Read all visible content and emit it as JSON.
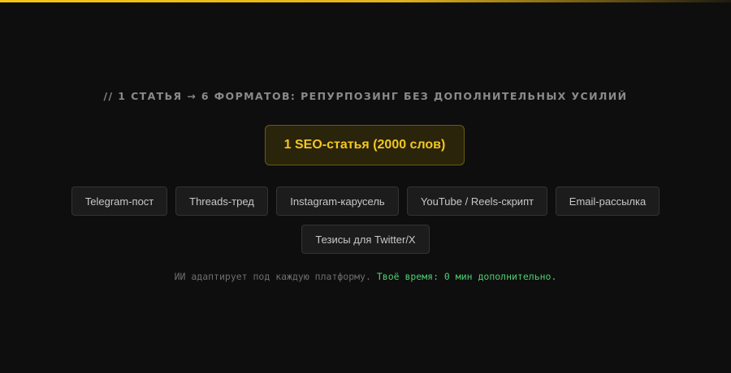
{
  "colors": {
    "accent_yellow": "#f3c623",
    "accent_green": "#4ccf72",
    "background": "#0e0e0e"
  },
  "heading": "// 1 СТАТЬЯ → 6 ФОРМАТОВ: РЕПУРПОЗИНГ БЕЗ ДОПОЛНИТЕЛЬНЫХ УСИЛИЙ",
  "source": {
    "label": "1 SEO-статья (2000 слов)"
  },
  "formats": [
    "Telegram-пост",
    "Threads-тред",
    "Instagram-карусель",
    "YouTube / Reels-скрипт",
    "Email-рассылка",
    "Тезисы для Twitter/X"
  ],
  "footnote": {
    "text": "ИИ адаптирует под каждую платформу.",
    "highlight": "Твоё время: 0 мин дополнительно."
  }
}
